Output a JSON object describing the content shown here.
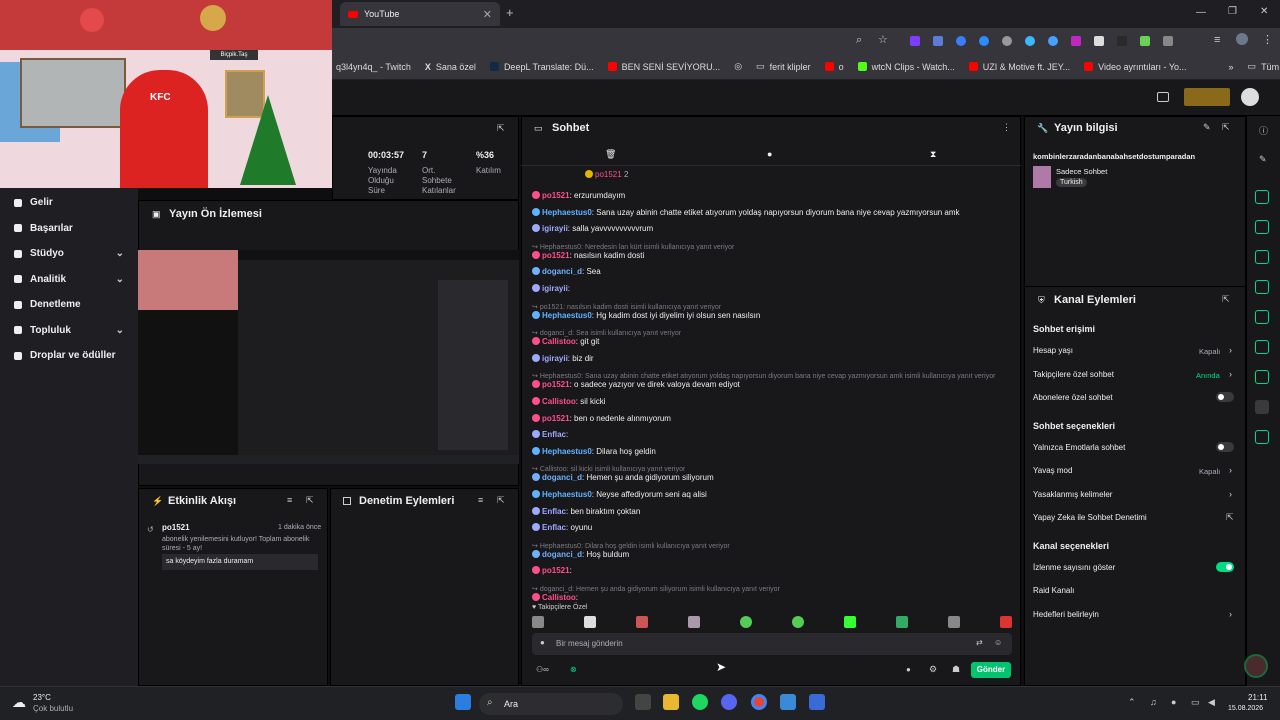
{
  "browser": {
    "tab_title": "YouTube",
    "bookmarks": [
      "q3l4yn4q_ - Twitch",
      "Sana özel",
      "DeepL Translate: Dü...",
      "BEN SENİ SEVİYORU...",
      "o",
      "ferit klipler",
      "o",
      "wtcN Clips - Watch...",
      "UZI & Motive ft. JEY...",
      "Video ayrıntıları - Yo...",
      "Tüm Yer İşaretleri"
    ]
  },
  "overlay": {
    "kfc": "KFC",
    "sign": "Biçpik.Taş"
  },
  "nav": [
    "Gelir",
    "Başarılar",
    "Stüdyo",
    "Analitik",
    "Denetleme",
    "Topluluk",
    "Droplar ve ödüller"
  ],
  "stats": [
    {
      "value": "00:03:57",
      "label": "Yayında Olduğu Süre"
    },
    {
      "value": "7",
      "label": "Ort. Sohbete Katılanlar"
    },
    {
      "value": "%36",
      "label": "Katılım"
    }
  ],
  "preview": {
    "title": "Yayın Ön İzlemesi"
  },
  "activity": {
    "title": "Etkinlik Akışı",
    "user": "po1521",
    "time": "1 dakika önce",
    "text": "abonelik yenilemesini kutluyor! Toplam abonelik süresi - 5 ay!",
    "msg": "sa köydeyim fazla duramam"
  },
  "modactions": {
    "title": "Denetim Eylemleri"
  },
  "chat": {
    "title": "Sohbet",
    "pinned": "po1521",
    "pinned_count": "2",
    "lines": [
      {
        "user": "po1521",
        "text": ": erzurumdayım",
        "color": "#ff4f8b"
      },
      {
        "user": "Hephaestus0",
        "text": ": Sana uzay abinin chatte etiket atıyorum yoldaş napıyorsun diyorum bana niye cevap yazmıyorsun amk",
        "color": "#5fb3ff"
      },
      {
        "user": "igirayii",
        "text": ": salla yavvvvvvvvvvrum",
        "color": "#9ea9ff"
      },
      {
        "reply": "Hephaestus0: Neredesin lan kürt isimli kullanıcıya yanıt veriyor"
      },
      {
        "user": "po1521",
        "text": ": nasılsın kadim dosti",
        "color": "#ff4f8b"
      },
      {
        "user": "doganci_d",
        "text": ": Sea",
        "color": "#6fb0ff"
      },
      {
        "user": "igirayii",
        "text": ":",
        "color": "#9ea9ff"
      },
      {
        "reply": "po1521: nasılsın kadim dosti isimli kullanıcıya yanıt veriyor"
      },
      {
        "user": "Hephaestus0",
        "text": ": Hg kadim dost iyi diyelim iyi olsun sen nasılsın",
        "color": "#5fb3ff"
      },
      {
        "reply": "doganci_d: Sea isimli kullanıcıya yanıt veriyor"
      },
      {
        "user": "Callistoo",
        "text": ": git git",
        "color": "#ff4f8b"
      },
      {
        "user": "igirayii",
        "text": ": biz dir",
        "color": "#9ea9ff"
      },
      {
        "reply": "Hephaestus0: Sana uzay abinin chatte etiket atıyorum yoldaş napıyorsun diyorum bana niye cevap yazmıyorsun amk isimli kullanıcıya yanıt veriyor"
      },
      {
        "user": "po1521",
        "text": ": o sadece yazıyor ve direk valoya devam ediyot",
        "color": "#ff4f8b"
      },
      {
        "user": "Callistoo",
        "text": ": sil kicki",
        "color": "#ff4f8b"
      },
      {
        "user": "po1521",
        "text": ": ben o nedenle alınmıyorum",
        "color": "#ff4f8b"
      },
      {
        "user": "Enflac",
        "text": ":",
        "color": "#9ea9ff"
      },
      {
        "user": "Hephaestus0",
        "text": ": Dilara hoş geldin",
        "color": "#5fb3ff"
      },
      {
        "reply": "Callistoo: sil kicki isimli kullanıcıya yanıt veriyor"
      },
      {
        "user": "doganci_d",
        "text": ": Hemen şu anda gidiyorum siliyorum",
        "color": "#6fb0ff"
      },
      {
        "user": "Hephaestus0",
        "text": ": Neyse affediyorum seni aq alisi",
        "color": "#5fb3ff"
      },
      {
        "user": "Enflac",
        "text": ": ben biraktım çoktan",
        "color": "#9ea9ff"
      },
      {
        "user": "Enflac",
        "text": ": oyunu",
        "color": "#9ea9ff"
      },
      {
        "reply": "Hephaestus0: Dilara hoş geldin isimli kullanıcıya yanıt veriyor"
      },
      {
        "user": "doganci_d",
        "text": ": Hoş buldum",
        "color": "#6fb0ff"
      },
      {
        "user": "po1521",
        "text": ":",
        "color": "#ff4f8b"
      },
      {
        "reply": "doganci_d: Hemen şu anda gidiyorum siliyorum isimli kullanıcıya yanıt veriyor"
      },
      {
        "user": "Callistoo",
        "text": ":",
        "color": "#ff4f8b"
      }
    ],
    "emote_label": "Takipçilere Özel",
    "placeholder": "Bir mesaj gönderin",
    "send": "Gönder"
  },
  "info": {
    "title": "Yayın bilgisi",
    "stream_title": "kombinlerzaradanbanabahsetdostumparadan",
    "category": "Sadece Sohbet",
    "tag": "Turkish"
  },
  "channel_actions": {
    "title": "Kanal Eylemleri",
    "rows": [
      {
        "label": "Sohbet erişimi",
        "head": true
      },
      {
        "label": "Hesap yaşı",
        "value": "Kapalı",
        "arrow": true
      },
      {
        "label": "Takipçilere özel sohbet",
        "value": "Anında",
        "green": true,
        "arrow": true
      },
      {
        "label": "Abonelere özel sohbet",
        "toggle": "off"
      },
      {
        "label": "Sohbet seçenekleri",
        "head": true
      },
      {
        "label": "Yalnızca Emotlarla sohbet",
        "toggle": "off"
      },
      {
        "label": "Yavaş mod",
        "value": "Kapalı",
        "arrow": true
      },
      {
        "label": "Yasaklanmış kelimeler",
        "arrow": true
      },
      {
        "label": "Yapay Zeka ile Sohbet Denetimi",
        "ext": true
      },
      {
        "label": "Kanal seçenekleri",
        "head": true
      },
      {
        "label": "İzlenme sayısını göster",
        "toggle": "on"
      },
      {
        "label": "Raid Kanalı"
      },
      {
        "label": "Hedefleri belirleyin",
        "arrow": true
      }
    ]
  },
  "taskbar": {
    "temp": "23°C",
    "weather": "Çok bulutlu",
    "search": "Ara",
    "time": "21:11",
    "date": "15.08.2026"
  }
}
